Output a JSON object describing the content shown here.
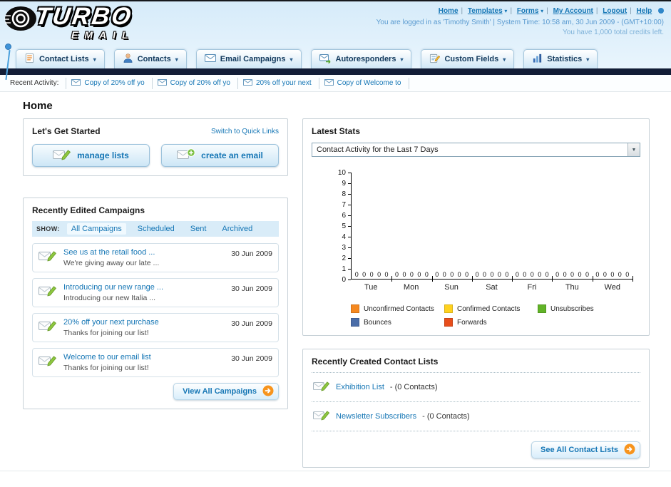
{
  "icons": {
    "dropdown_arrow": "▾",
    "select_arrow": "▼",
    "nav_separator": "|"
  },
  "header": {
    "logo": {
      "line1": "TURBO",
      "line2": "EMAIL"
    },
    "nav": [
      {
        "label": "Home"
      },
      {
        "label": "Templates",
        "has_arrow": true
      },
      {
        "label": "Forms",
        "has_arrow": true
      },
      {
        "label": "My Account"
      },
      {
        "label": "Logout"
      },
      {
        "label": "Help"
      }
    ],
    "login_info": "You are logged in as 'Timothy Smith' | System Time: 10:58 am, 30 Jun 2009 - (GMT+10:00)",
    "credits_info": "You have 1,000 total credits left."
  },
  "main_nav": {
    "tabs": [
      {
        "label": "Contact Lists"
      },
      {
        "label": "Contacts"
      },
      {
        "label": "Email Campaigns"
      },
      {
        "label": "Autoresponders"
      },
      {
        "label": "Custom Fields"
      },
      {
        "label": "Statistics"
      }
    ]
  },
  "activity_bar": {
    "label": "Recent Activity:",
    "items": [
      {
        "label": "Copy of 20% off yo"
      },
      {
        "label": "Copy of 20% off yo"
      },
      {
        "label": "20% off your next"
      },
      {
        "label": "Copy of Welcome to"
      }
    ]
  },
  "page": {
    "title": "Home"
  },
  "get_started": {
    "title": "Let's Get Started",
    "switch_link": "Switch to Quick Links",
    "manage_lists_label": "manage lists",
    "create_email_label": "create an email"
  },
  "campaigns": {
    "title": "Recently Edited Campaigns",
    "show_label": "SHOW:",
    "filters": [
      {
        "label": "All Campaigns",
        "active": true
      },
      {
        "label": "Scheduled"
      },
      {
        "label": "Sent"
      },
      {
        "label": "Archived"
      }
    ],
    "items": [
      {
        "title": "See us at the retail food ...",
        "subtitle": "We're giving away our late ...",
        "date": "30 Jun 2009"
      },
      {
        "title": "Introducing our new range ...",
        "subtitle": "Introducing our new Italia ...",
        "date": "30 Jun 2009"
      },
      {
        "title": "20% off your next purchase",
        "subtitle": "Thanks for joining our list!",
        "date": "30 Jun 2009"
      },
      {
        "title": "Welcome to our email list",
        "subtitle": "Thanks for joining our list!",
        "date": "30 Jun 2009"
      }
    ],
    "view_all_label": "View All Campaigns"
  },
  "stats": {
    "title": "Latest Stats",
    "selector_value": "Contact Activity for the Last 7 Days"
  },
  "chart_data": {
    "type": "bar",
    "title": "Contact Activity for the Last 7 Days",
    "categories": [
      "Tue",
      "Mon",
      "Sun",
      "Sat",
      "Fri",
      "Thu",
      "Wed"
    ],
    "series": [
      {
        "name": "Unconfirmed Contacts",
        "color": "#f5881f",
        "values": [
          0,
          0,
          0,
          0,
          0,
          0,
          0
        ]
      },
      {
        "name": "Confirmed Contacts",
        "color": "#ffd21e",
        "values": [
          0,
          0,
          0,
          0,
          0,
          0,
          0
        ]
      },
      {
        "name": "Unsubscribes",
        "color": "#61b327",
        "values": [
          0,
          0,
          0,
          0,
          0,
          0,
          0
        ]
      },
      {
        "name": "Bounces",
        "color": "#4a6da8",
        "values": [
          0,
          0,
          0,
          0,
          0,
          0,
          0
        ]
      },
      {
        "name": "Forwards",
        "color": "#e84e1b",
        "values": [
          0,
          0,
          0,
          0,
          0,
          0,
          0
        ]
      }
    ],
    "ylim": [
      0,
      10
    ],
    "ytick_step": 1,
    "grid": false,
    "legend_position": "bottom"
  },
  "contact_lists": {
    "title": "Recently Created Contact Lists",
    "items": [
      {
        "name": "Exhibition List",
        "suffix": "- (0 Contacts)"
      },
      {
        "name": "Newsletter Subscribers",
        "suffix": "- (0 Contacts)"
      }
    ],
    "see_all_label": "See All Contact Lists"
  }
}
